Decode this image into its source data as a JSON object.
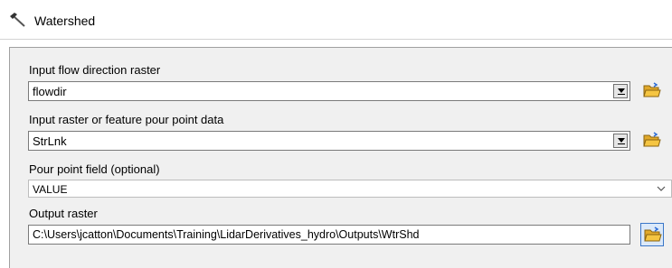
{
  "window": {
    "title": "Watershed",
    "icon": "hammer-icon"
  },
  "form": {
    "flow_direction": {
      "label": "Input flow direction raster",
      "value": "flowdir",
      "browse_icon": "open-folder-icon"
    },
    "pour_point_data": {
      "label": "Input raster or feature pour point data",
      "value": "StrLnk",
      "browse_icon": "open-folder-icon"
    },
    "pour_point_field": {
      "label": "Pour point field (optional)",
      "value": "VALUE"
    },
    "output_raster": {
      "label": "Output raster",
      "value": "C:\\Users\\jcatton\\Documents\\Training\\LidarDerivatives_hydro\\Outputs\\WtrShd",
      "browse_icon": "open-folder-icon"
    }
  },
  "colors": {
    "panel_bg": "#f0f0f0",
    "field_border": "#7a7a7a",
    "focus_blue": "#3a76c8",
    "folder_yellow": "#f5c542"
  }
}
